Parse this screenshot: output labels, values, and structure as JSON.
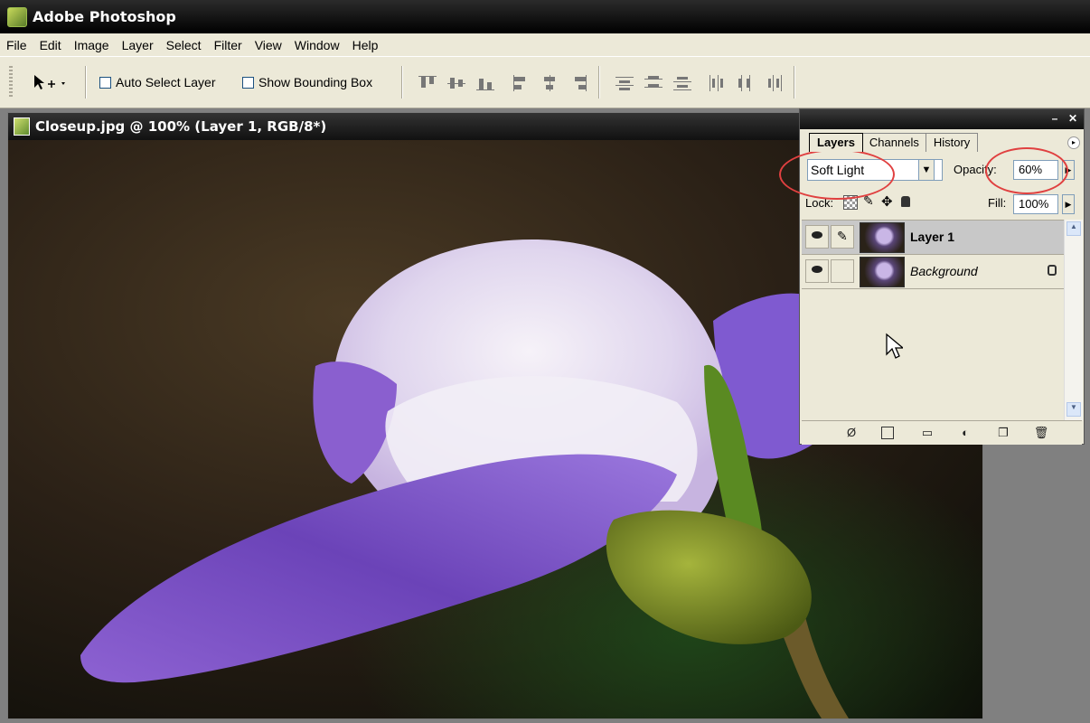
{
  "app": {
    "title": "Adobe Photoshop"
  },
  "menu": {
    "items": [
      "File",
      "Edit",
      "Image",
      "Layer",
      "Select",
      "Filter",
      "View",
      "Window",
      "Help"
    ]
  },
  "options": {
    "auto_select_label": "Auto Select Layer",
    "auto_select_checked": false,
    "bounding_box_label": "Show Bounding Box",
    "bounding_box_checked": false
  },
  "document": {
    "title": "Closeup.jpg @ 100% (Layer 1, RGB/8*)"
  },
  "layers_panel": {
    "tabs": [
      "Layers",
      "Channels",
      "History"
    ],
    "active_tab": "Layers",
    "blend_mode": "Soft Light",
    "opacity_label": "Opacity:",
    "opacity_value": "60%",
    "lock_label": "Lock:",
    "fill_label": "Fill:",
    "fill_value": "100%",
    "layers": [
      {
        "name": "Layer 1",
        "selected": true,
        "visible": true
      },
      {
        "name": "Background",
        "selected": false,
        "visible": true,
        "locked": true
      }
    ]
  },
  "colors": {
    "highlight_ellipse": "#e04040",
    "panel_bg": "#ece9d8"
  }
}
